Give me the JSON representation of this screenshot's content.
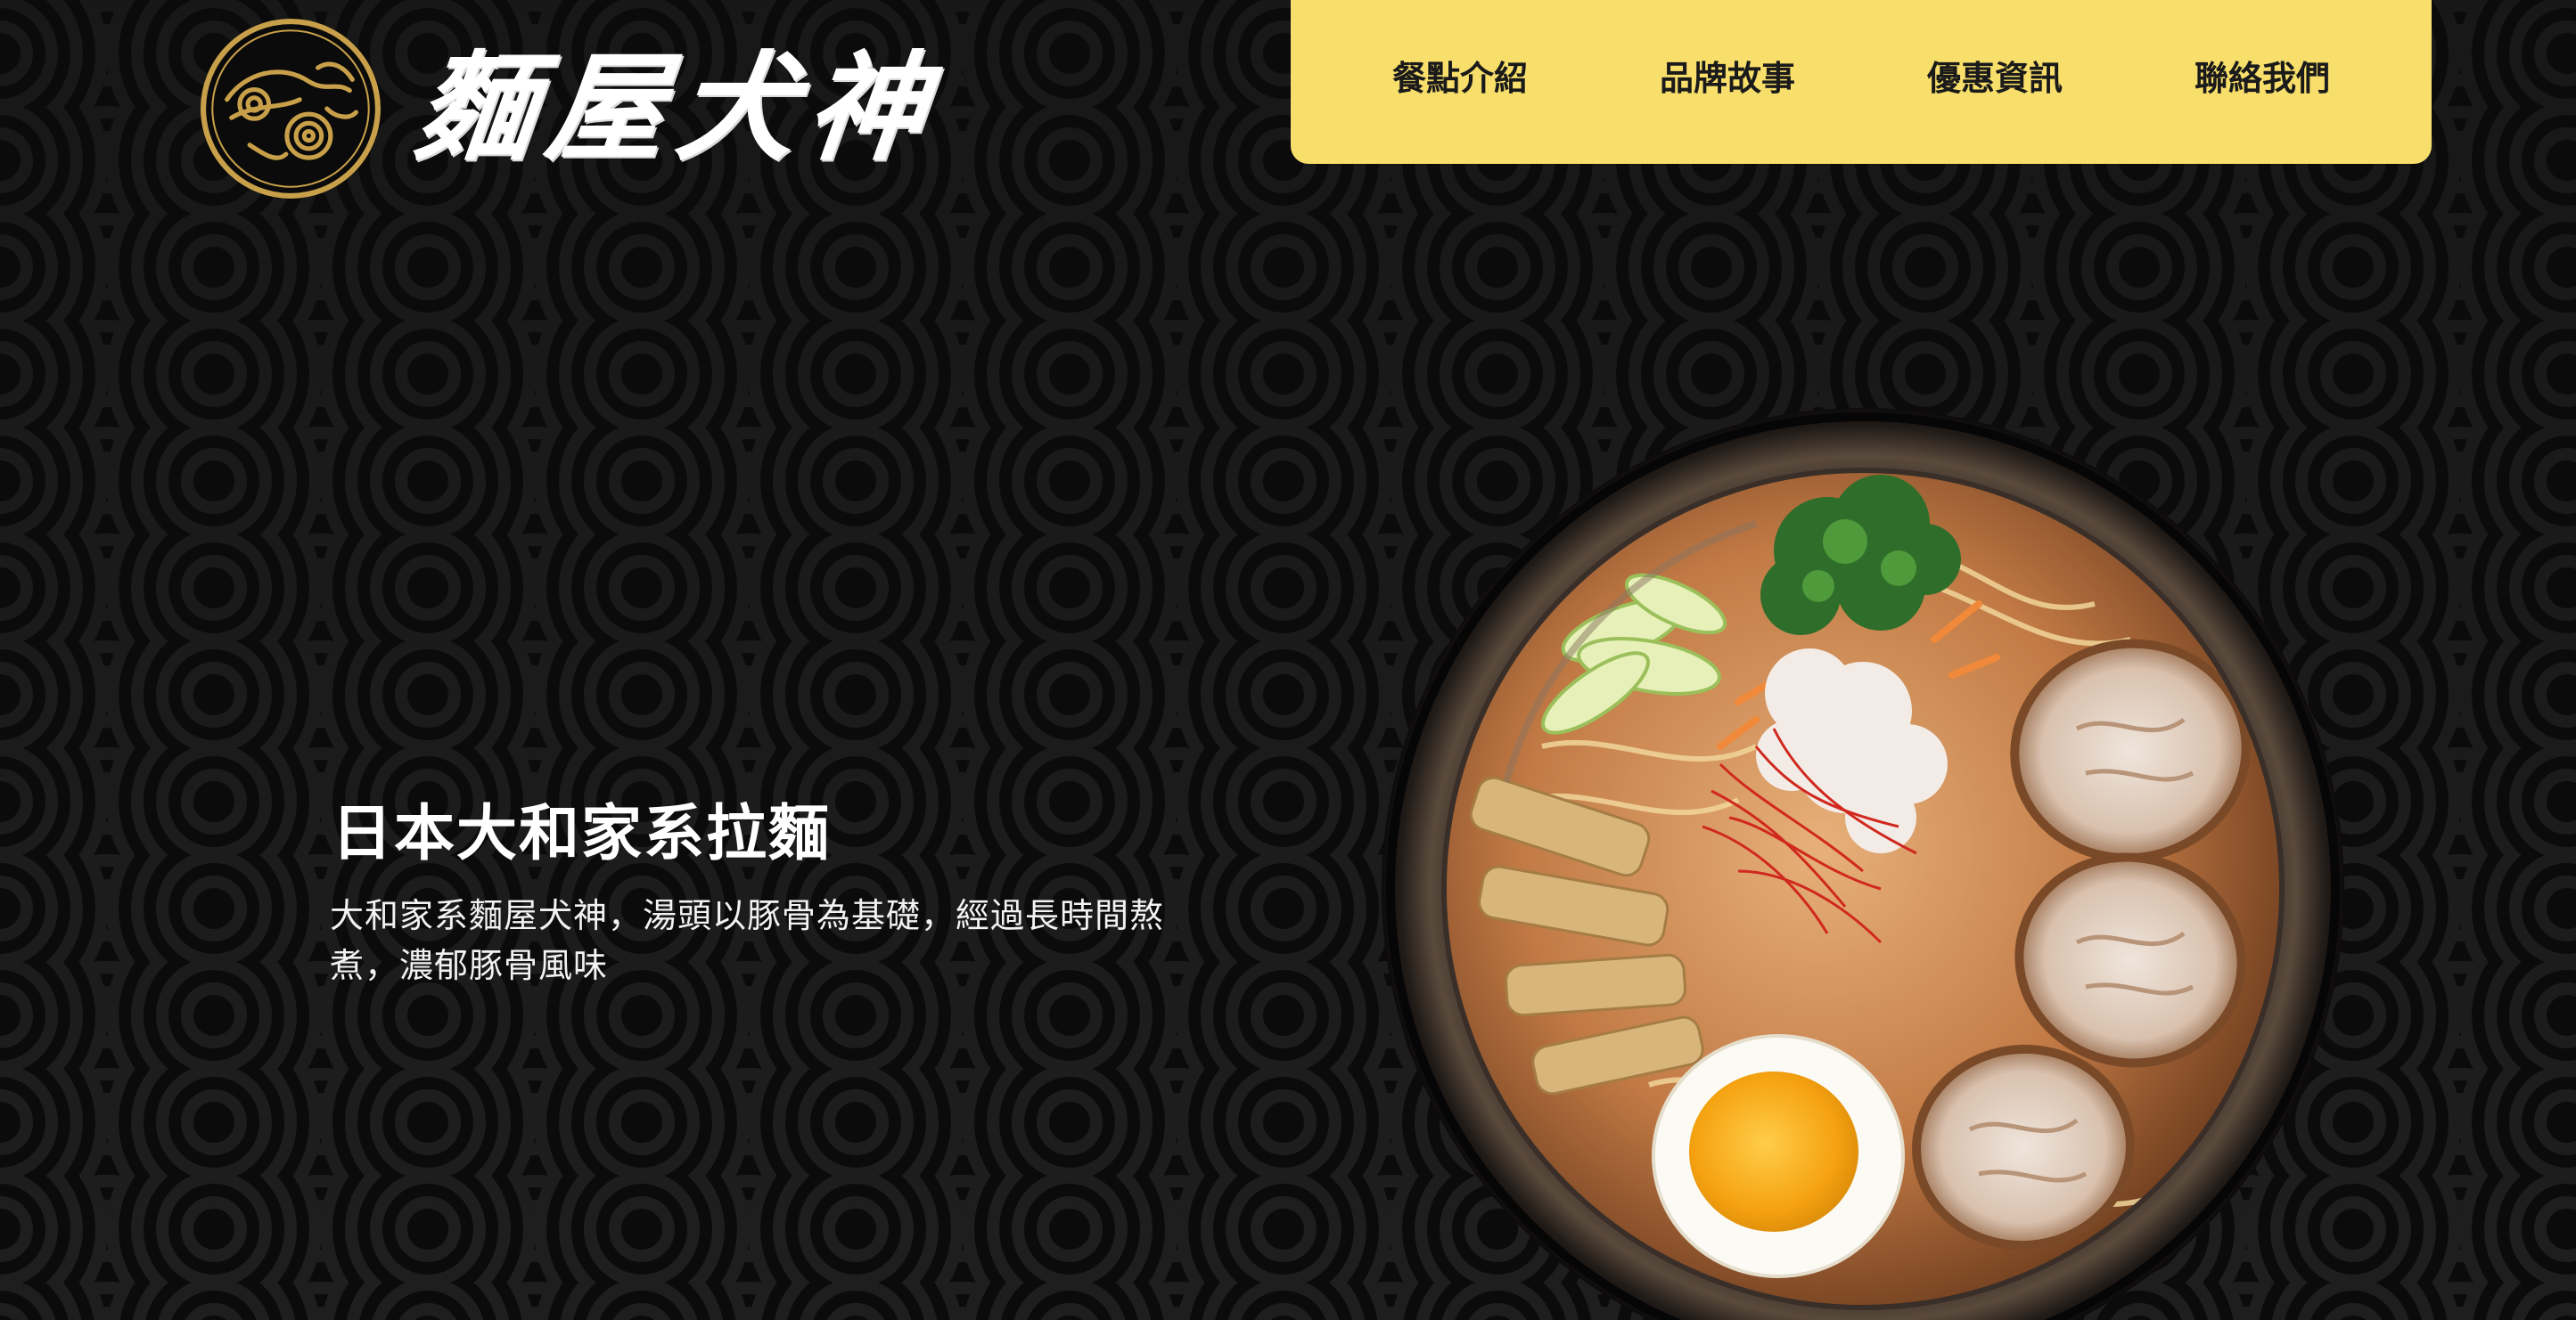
{
  "brand": {
    "name": "麵屋犬神",
    "accent_color": "#f8de6a",
    "seal_color": "#c9a04a"
  },
  "nav": {
    "items": [
      {
        "label": "餐點介紹",
        "name": "nav-item-menu"
      },
      {
        "label": "品牌故事",
        "name": "nav-item-story"
      },
      {
        "label": "優惠資訊",
        "name": "nav-item-promotions"
      },
      {
        "label": "聯絡我們",
        "name": "nav-item-contact"
      }
    ]
  },
  "hero": {
    "title": "日本大和家系拉麵",
    "description": "大和家系麵屋犬神，湯頭以豚骨為基礎，經過長時間熬煮，濃郁豚骨風味"
  },
  "images": {
    "hero_dish": "ramen-bowl-image"
  }
}
